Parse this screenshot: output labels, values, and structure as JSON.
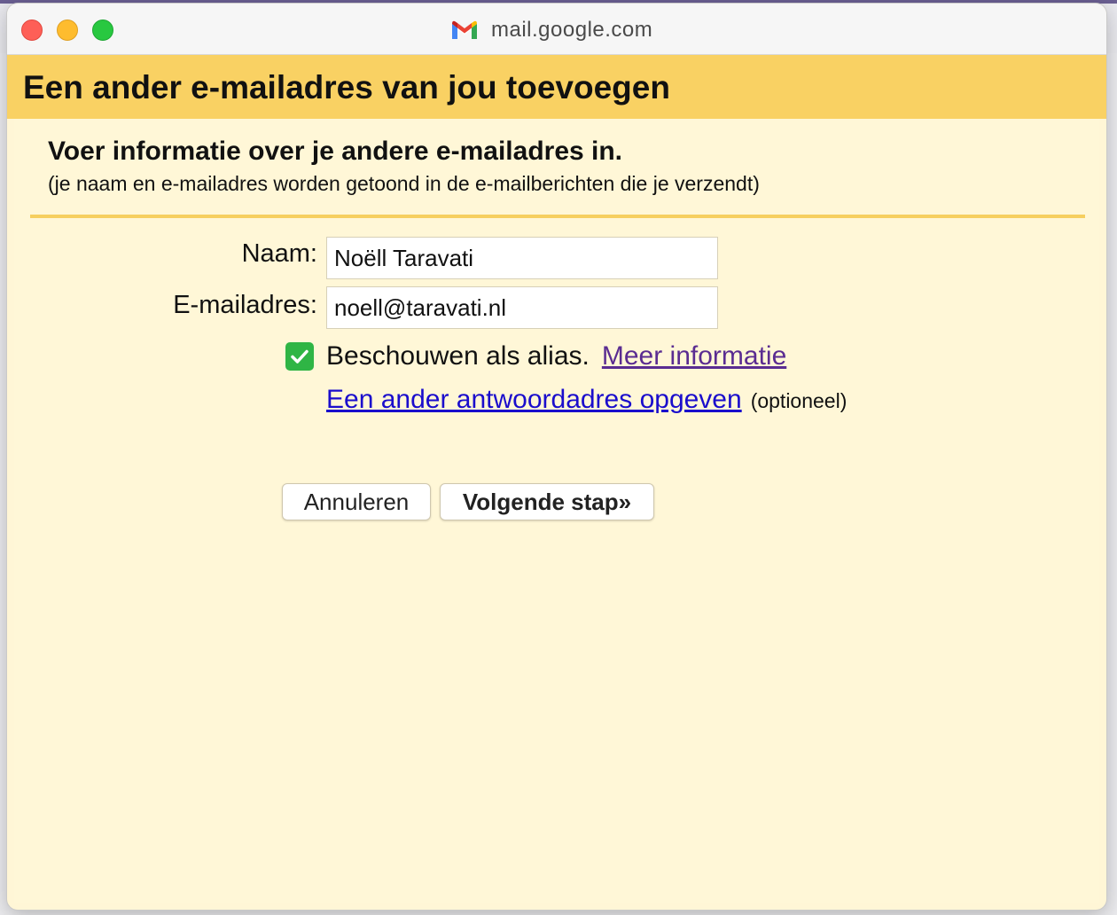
{
  "window": {
    "url": "mail.google.com",
    "icon": "gmail-icon"
  },
  "header": {
    "title": "Een ander e-mailadres van jou toevoegen"
  },
  "section": {
    "title": "Voer informatie over je andere e-mailadres in.",
    "subtitle": "(je naam en e-mailadres worden getoond in de e-mailberichten die je verzendt)"
  },
  "form": {
    "name_label": "Naam:",
    "name_value": "Noëll Taravati",
    "email_label": "E-mailadres:",
    "email_value": "noell@taravati.nl",
    "alias_checked": true,
    "alias_label": "Beschouwen als alias.",
    "alias_link": "Meer informatie",
    "reply_link": "Een ander antwoordadres opgeven",
    "reply_optional": "(optioneel)"
  },
  "buttons": {
    "cancel": "Annuleren",
    "next": "Volgende stap»"
  },
  "colors": {
    "header_bg": "#f9d163",
    "content_bg": "#fff7d7",
    "divider": "#f6cf5f",
    "checkbox": "#2fb545",
    "visited_link": "#5a2c91",
    "link": "#1a0dcc"
  }
}
